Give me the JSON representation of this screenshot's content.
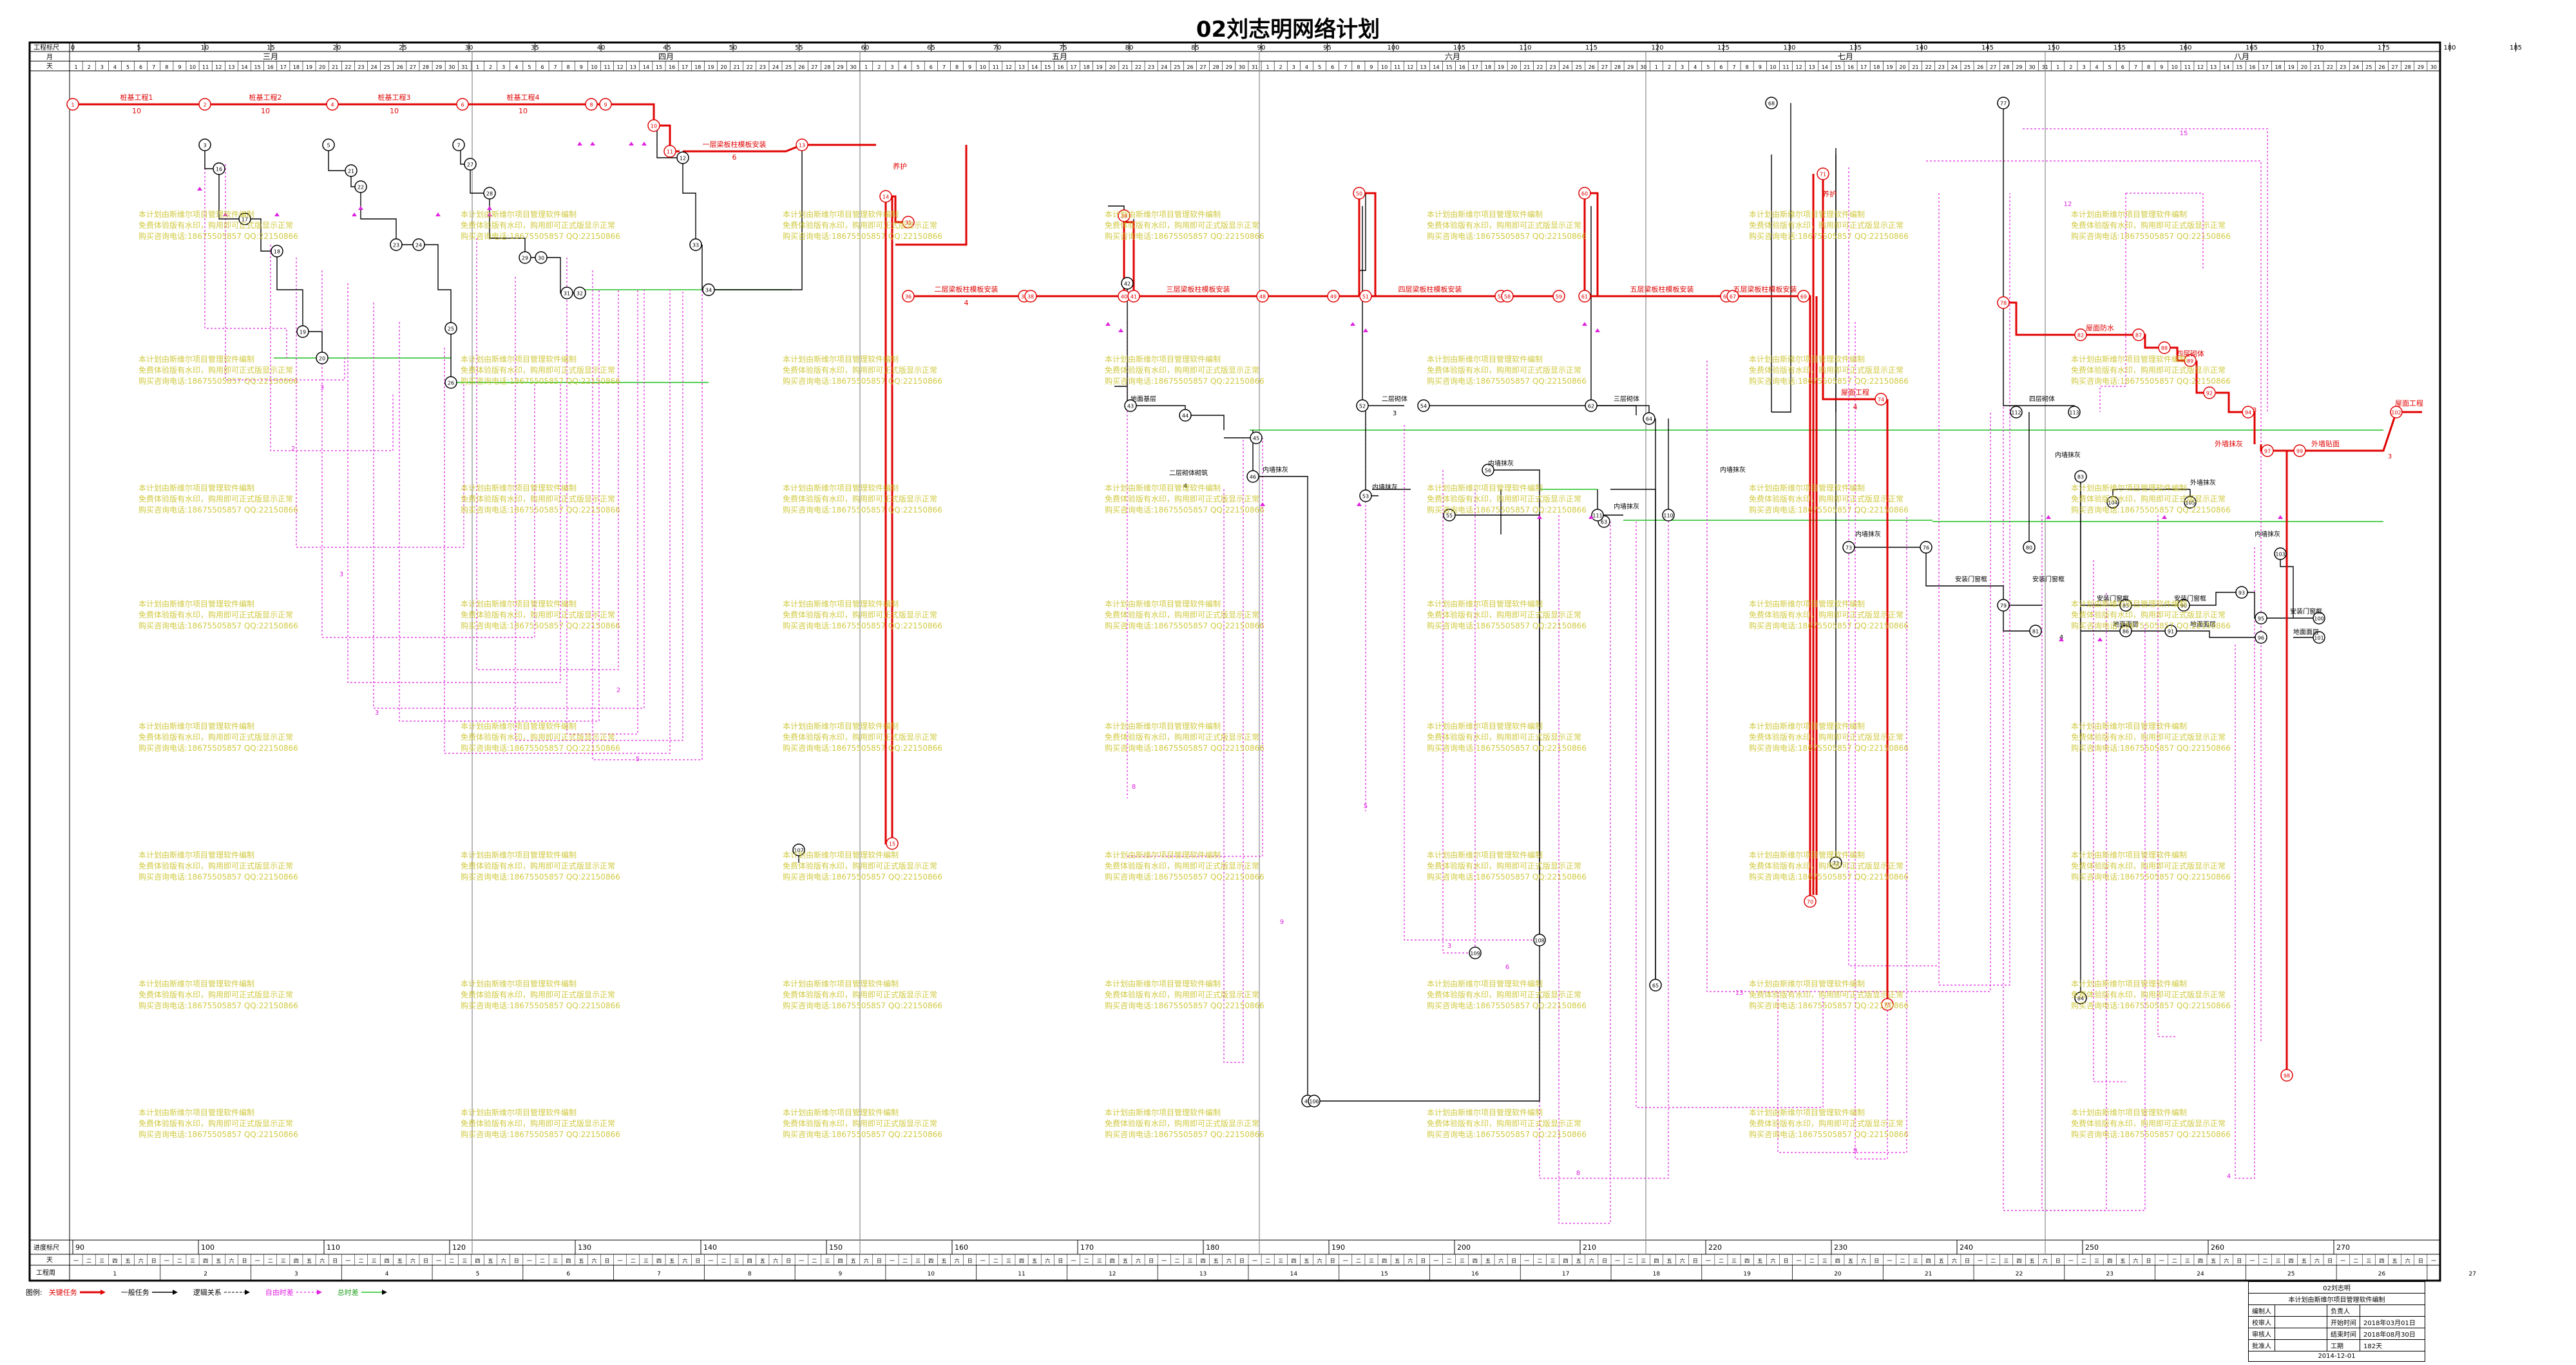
{
  "title": "02刘志明网络计划",
  "scale": {
    "top_row_label": "工程标尺",
    "month_row_label": "月",
    "day_row_label": "天",
    "bottom_scale_label": "进度标尺",
    "bottom_day_label": "天",
    "bottom_week_label": "工程周",
    "ticks": [
      "0",
      "5",
      "10",
      "15",
      "20",
      "25",
      "30",
      "35",
      "40",
      "45",
      "50",
      "55",
      "60",
      "65",
      "70",
      "75",
      "80",
      "85",
      "90",
      "95",
      "100",
      "105",
      "110",
      "115",
      "120",
      "125",
      "130",
      "135",
      "140",
      "145",
      "150",
      "155",
      "160",
      "165",
      "170",
      "175",
      "180",
      "185"
    ],
    "bottom_ticks": [
      "90",
      "100",
      "110",
      "120",
      "130",
      "140",
      "150",
      "160",
      "170",
      "180",
      "190",
      "200",
      "210",
      "220",
      "230",
      "240",
      "250",
      "260",
      "270"
    ],
    "months": [
      "三月",
      "四月",
      "五月",
      "六月",
      "七月",
      "八月"
    ],
    "weekdays": [
      "一",
      "二",
      "三",
      "四",
      "五",
      "六",
      "日"
    ]
  },
  "tasks": {
    "t1": "桩基工程1",
    "t2": "桩基工程2",
    "t3": "桩基工程3",
    "t4": "桩基工程4",
    "t5": "一层梁板柱模板安装",
    "t6": "二层梁板柱模板安装",
    "t7": "三层梁板柱模板安装",
    "t8": "四层梁板柱模板安装",
    "t9": "五层梁板柱模板安装",
    "t10": "一层砌体",
    "t11": "二层砌体",
    "t12": "三层砌体",
    "t13": "四层砌体",
    "t14": "二层砌体砌筑",
    "t15": "地面基层",
    "t16": "内墙抹灰",
    "t17": "屋面防水",
    "t18": "外墙抹灰",
    "t19": "安装门窗框",
    "t20": "地面面层",
    "t21": "外墙贴面",
    "t22": "养护",
    "t23": "屋面工程"
  },
  "durations": [
    "10",
    "10",
    "10",
    "10",
    "6",
    "4",
    "3",
    "3",
    "2",
    "4",
    "5",
    "8",
    "9",
    "13",
    "15",
    "12"
  ],
  "watermark": [
    "本计划由斯维尔项目管理软件编制",
    "免费体验版有水印，购用即可正式版显示正常",
    "购买咨询电话:18675505857 QQ:22150866"
  ],
  "legend": {
    "prefix": "图例:",
    "critical": "关键任务",
    "normal": "一般任务",
    "logic": "逻辑关系",
    "free_float": "自由时差",
    "total_float": "总时差"
  },
  "info": {
    "project": "02刘志明",
    "company": "本计划由斯维尔项目管理软件编制",
    "rows": [
      {
        "k1": "编制人",
        "v1": "",
        "k2": "负责人",
        "v2": ""
      },
      {
        "k1": "校审人",
        "v1": "",
        "k2": "开始时间",
        "v2": "2018年03月01日"
      },
      {
        "k1": "审核人",
        "v1": "",
        "k2": "结束时间",
        "v2": "2018年08月30日"
      },
      {
        "k1": "批准人",
        "v1": "",
        "k2": "工期",
        "v2": "182天"
      }
    ],
    "date": "2014-12-01"
  },
  "colors": {
    "critical": "#e00000",
    "normal": "#000000",
    "free_float": "#e020e0",
    "total_float": "#20c020",
    "watermark": "#c8c020"
  }
}
